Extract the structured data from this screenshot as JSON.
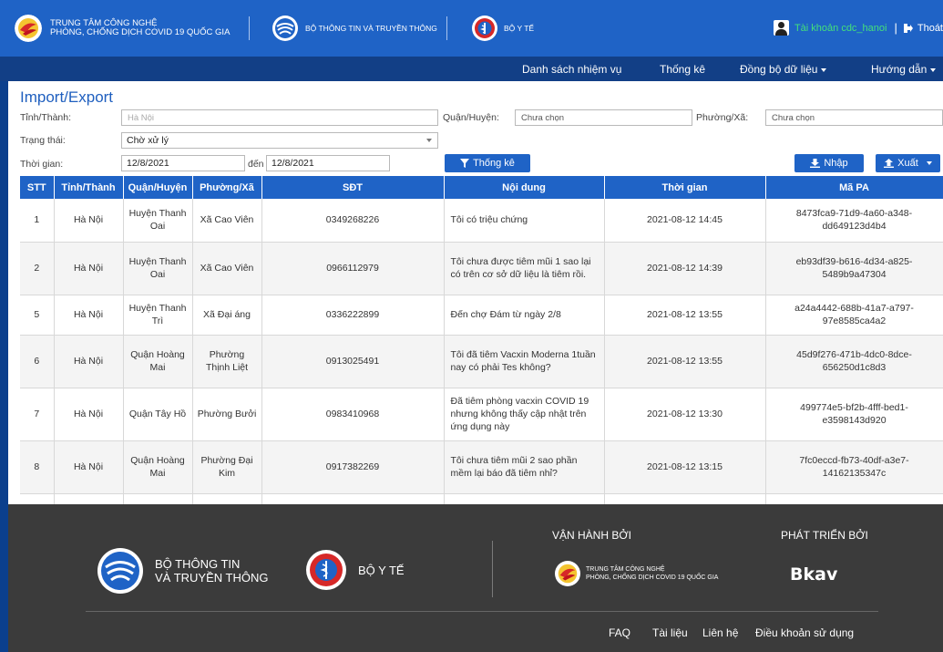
{
  "header": {
    "org_line1": "TRUNG TÂM CÔNG NGHỆ",
    "org_line2": "PHÒNG, CHỐNG DỊCH COVID 19 QUỐC GIA",
    "ministry_ict": "BỘ THÔNG TIN VÀ TRUYỀN THÔNG",
    "ministry_health": "BỘ Y TẾ",
    "account_label": "Tài khoản cdc_hanoi",
    "logout_label": "Thoát",
    "colors": {
      "header_bg": "#1f63c6",
      "nav_bg": "#123f86",
      "account_green": "#43e07b"
    }
  },
  "nav": {
    "tasks": "Danh sách nhiệm vụ",
    "stats": "Thống kê",
    "sync": "Đồng bộ dữ liệu",
    "guide": "Hướng dẫn"
  },
  "page": {
    "title": "Import/Export"
  },
  "filters": {
    "province_label": "Tỉnh/Thành:",
    "province_value": "Hà Nội",
    "district_label": "Quận/Huyện:",
    "district_value": "Chưa chọn",
    "ward_label": "Phường/Xã:",
    "ward_value": "Chưa chọn",
    "status_label": "Trạng thái:",
    "status_value": "Chờ xử lý",
    "time_label": "Thời gian:",
    "date_from": "12/8/2021",
    "to_label": "đến",
    "date_to": "12/8/2021",
    "stats_button": "Thống kê",
    "import_button": "Nhập",
    "export_button": "Xuất"
  },
  "table": {
    "columns": [
      "STT",
      "Tỉnh/Thành",
      "Quận/Huyện",
      "Phường/Xã",
      "SĐT",
      "Nội dung",
      "Thời gian",
      "Mã PA"
    ],
    "rows": [
      [
        "1",
        "Hà Nội",
        "Huyện Thanh Oai",
        "Xã Cao Viên",
        "0349268226",
        "Tôi có triệu chứng",
        "2021-08-12 14:45",
        "8473fca9-71d9-4a60-a348-dd649123d4b4"
      ],
      [
        "2",
        "Hà Nội",
        "Huyện Thanh Oai",
        "Xã Cao Viên",
        "0966112979",
        "Tôi chưa được tiêm mũi 1 sao lại có trên cơ sở dữ liệu là tiêm rồi.",
        "2021-08-12 14:39",
        "eb93df39-b616-4d34-a825-5489b9a47304"
      ],
      [
        "5",
        "Hà Nội",
        "Huyện Thanh Trì",
        "Xã Đại áng",
        "0336222899",
        "Đến chợ Đám từ ngày 2/8",
        "2021-08-12 13:55",
        "a24a4442-688b-41a7-a797-97e8585ca4a2"
      ],
      [
        "6",
        "Hà Nội",
        "Quận Hoàng Mai",
        "Phường Thịnh Liệt",
        "0913025491",
        "Tôi đã tiêm Vacxin Moderna 1tuần nay có phải Tes không?",
        "2021-08-12 13:55",
        "45d9f276-471b-4dc0-8dce-656250d1c8d3"
      ],
      [
        "7",
        "Hà Nội",
        "Quận Tây Hồ",
        "Phường Bưởi",
        "0983410968",
        "Đã tiêm phòng vacxin COVID 19 nhưng không thấy cập nhật trên ứng dụng này",
        "2021-08-12 13:30",
        "499774e5-bf2b-4fff-bed1-e3598143d920"
      ],
      [
        "8",
        "Hà Nội",
        "Quận Hoàng Mai",
        "Phường Đại Kim",
        "0917382269",
        "Tôi chưa tiêm mũi 2 sao phần mềm lại báo đã tiêm nhỉ?",
        "2021-08-12 13:15",
        "7fc0eccd-fb73-40df-a3e7-14162135347c"
      ]
    ]
  },
  "footer": {
    "ict_line1": "BỘ THÔNG TIN",
    "ict_line2": "VÀ TRUYỀN THÔNG",
    "health": "BỘ Y TẾ",
    "operated_by": "VẬN HÀNH BỞI",
    "developed_by": "PHÁT TRIỂN BỞI",
    "org_line1": "TRUNG TÂM CÔNG NGHỆ",
    "org_line2": "PHÒNG, CHỐNG DỊCH COVID 19 QUỐC GIA",
    "developer": "Bkav",
    "links": {
      "faq": "FAQ",
      "docs": "Tài liệu",
      "contact": "Liên hệ",
      "terms": "Điều khoản sử dụng"
    }
  }
}
